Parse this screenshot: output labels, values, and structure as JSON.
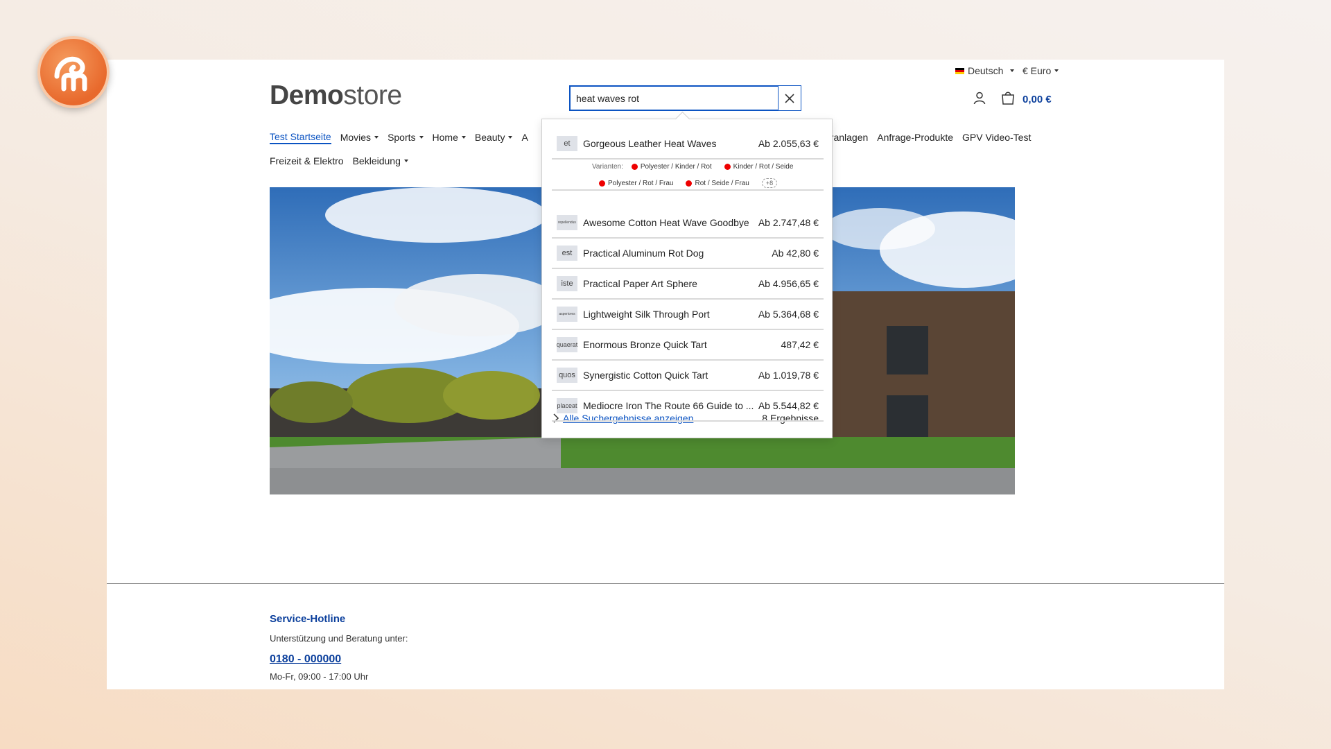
{
  "header": {
    "brand_bold": "Demo",
    "brand_light": "store",
    "language": "Deutsch",
    "currency": "€ Euro",
    "cart_total": "0,00 €"
  },
  "search": {
    "value": "heat waves rot"
  },
  "nav": {
    "row1": [
      "Test Startseite",
      "Movies",
      "Sports",
      "Home",
      "Beauty",
      "A"
    ],
    "row1_has_dropdown": [
      false,
      true,
      true,
      true,
      true,
      false
    ],
    "row1_right": [
      "eranlagen",
      "Anfrage-Produkte",
      "GPV Video-Test"
    ],
    "row2": [
      "Freizeit & Elektro",
      "Bekleidung"
    ],
    "row2_has_dropdown": [
      false,
      true
    ]
  },
  "suggestions": {
    "items": [
      {
        "thumb": "et",
        "name": "Gorgeous Leather Heat Waves",
        "price": "Ab 2.055,63 €"
      },
      {
        "thumb": "repellendus",
        "name": "Awesome Cotton Heat Wave Goodbye",
        "price": "Ab 2.747,48 €"
      },
      {
        "thumb": "est",
        "name": "Practical Aluminum Rot Dog",
        "price": "Ab 42,80 €"
      },
      {
        "thumb": "iste",
        "name": "Practical Paper Art Sphere",
        "price": "Ab 4.956,65 €"
      },
      {
        "thumb": "asperiores",
        "name": "Lightweight Silk Through Port",
        "price": "Ab 5.364,68 €"
      },
      {
        "thumb": "quaerat",
        "name": "Enormous Bronze Quick Tart",
        "price": "487,42 €"
      },
      {
        "thumb": "quos",
        "name": "Synergistic Cotton Quick Tart",
        "price": "Ab 1.019,78 €"
      },
      {
        "thumb": "placeat",
        "name": "Mediocre Iron The Route 66 Guide to ...",
        "price": "Ab 5.544,82 €"
      }
    ],
    "variants_label": "Varianten:",
    "variants": [
      "Polyester / Kinder / Rot",
      "Kinder / Rot / Seide",
      "Polyester / Rot / Frau",
      "Rot / Seide / Frau"
    ],
    "variants_more": "+8",
    "show_all": "Alle Suchergebnisse anzeigen",
    "result_count": "8 Ergebnisse"
  },
  "footer": {
    "title": "Service-Hotline",
    "subtitle": "Unterstützung und Beratung unter:",
    "phone": "0180 - 000000",
    "hours": "Mo-Fr, 09:00 - 17:00 Uhr"
  },
  "colors": {
    "accent": "#0b53c2",
    "brand_blue": "#0b3f9c",
    "badge_orange": "#e8692c",
    "variant_dot": "#ee0000"
  }
}
